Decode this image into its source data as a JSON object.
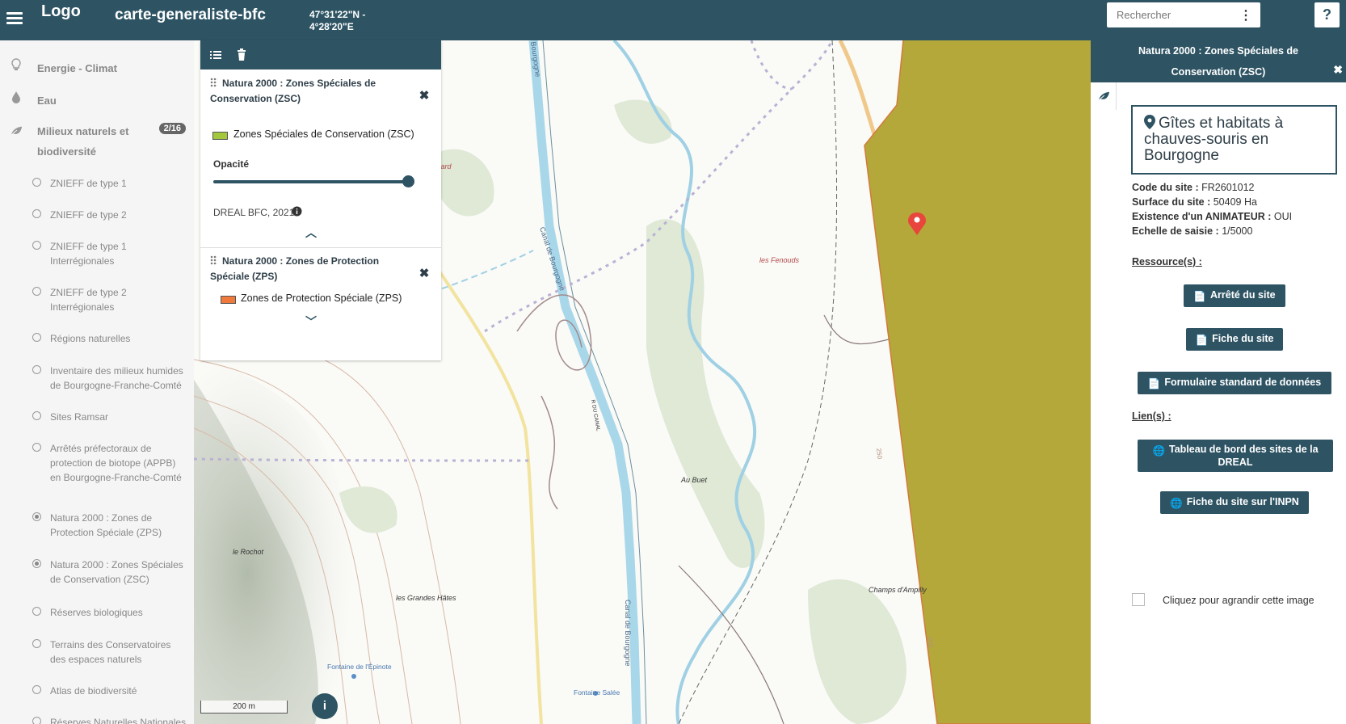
{
  "header": {
    "logo_alt": "Logo",
    "app_title": "carte-generaliste-bfc",
    "coord_lat": "47°31'22\"N -",
    "coord_lon": "4°28'20\"E",
    "search_placeholder": "Rechercher",
    "help_label": "?"
  },
  "sidebar": {
    "themes": [
      {
        "label": "Energie - Climat",
        "icon": "bulb-icon"
      },
      {
        "label": "Eau",
        "icon": "drop-icon"
      },
      {
        "label": "Milieux naturels et biodiversité",
        "icon": "leaf-icon",
        "badge": "2/16"
      }
    ],
    "layers": [
      {
        "label": "ZNIEFF de type 1",
        "checked": false
      },
      {
        "label": "ZNIEFF de type 2",
        "checked": false
      },
      {
        "label": "ZNIEFF de type 1 Interrégionales",
        "checked": false
      },
      {
        "label": "ZNIEFF de type 2 Interrégionales",
        "checked": false
      },
      {
        "label": "Régions naturelles",
        "checked": false
      },
      {
        "label": "Inventaire des milieux humides de Bourgogne-Franche-Comté",
        "checked": false
      },
      {
        "label": "Sites Ramsar",
        "checked": false
      },
      {
        "label": "Arrêtés préfectoraux de protection de biotope (APPB) en Bourgogne-Franche-Comté",
        "checked": false
      },
      {
        "label": "Natura 2000 : Zones de Protection Spéciale (ZPS)",
        "checked": true
      },
      {
        "label": "Natura 2000 : Zones Spéciales de Conservation (ZSC)",
        "checked": true
      },
      {
        "label": "Réserves biologiques",
        "checked": false
      },
      {
        "label": "Terrains des Conservatoires des espaces naturels",
        "checked": false
      },
      {
        "label": "Atlas de biodiversité",
        "checked": false
      },
      {
        "label": "Réserves Naturelles Nationales",
        "checked": false
      }
    ]
  },
  "legend": {
    "zsc": {
      "title": "Natura 2000 : Zones Spéciales de Conservation (ZSC)",
      "entry": "Zones Spéciales de Conservation (ZSC)",
      "color": "#a3c83c",
      "opacity_label": "Opacité",
      "opacity": 1.0,
      "source": "DREAL BFC, 2021"
    },
    "zps": {
      "title": "Natura 2000 : Zones de Protection Spéciale (ZPS)",
      "entry": "Zones de Protection Spéciale (ZPS)",
      "color": "#f07a3c"
    }
  },
  "map": {
    "labels": {
      "caulard": "Caulard",
      "fenouds": "les Fenouds",
      "buet": "Au Buet",
      "rochot": "le Rochot",
      "hates": "les Grandes Hâtes",
      "ampilly": "Champs d'Ampilly",
      "fontaine1": "Fontaine de l'Épinote",
      "fontaine2": "Fontaine Salée",
      "canal1": "Canal de Bourgogne",
      "canal2": "Canal de Bourgogne",
      "canal_top": "Bourgogne",
      "rdu": "R DU CANAL",
      "c250a": "250",
      "c250b": "250",
      "c250c": "250"
    },
    "scale": "200 m",
    "info_label": "i",
    "zone_color": "#b5a83a"
  },
  "panel": {
    "header_title": "Natura 2000 : Zones Spéciales de Conservation (ZSC)",
    "site_name": "Gîtes et habitats à chauves-souris en Bourgogne",
    "fields": [
      {
        "label": "Code du site :",
        "value": "FR2601012"
      },
      {
        "label": "Surface du site :",
        "value": "50409 Ha"
      },
      {
        "label": "Existence d'un ANIMATEUR :",
        "value": "OUI"
      },
      {
        "label": "Echelle de saisie :",
        "value": "1/5000"
      }
    ],
    "resources_title": "Ressource(s) :",
    "resources": [
      "Arrêté du site",
      "Fiche du site",
      "Formulaire standard de données"
    ],
    "links_title": "Lien(s) :",
    "links": [
      "Tableau de bord des sites de la DREAL",
      "Fiche du site sur l'INPN"
    ],
    "image_caption": "Cliquez pour agrandir cette image"
  }
}
